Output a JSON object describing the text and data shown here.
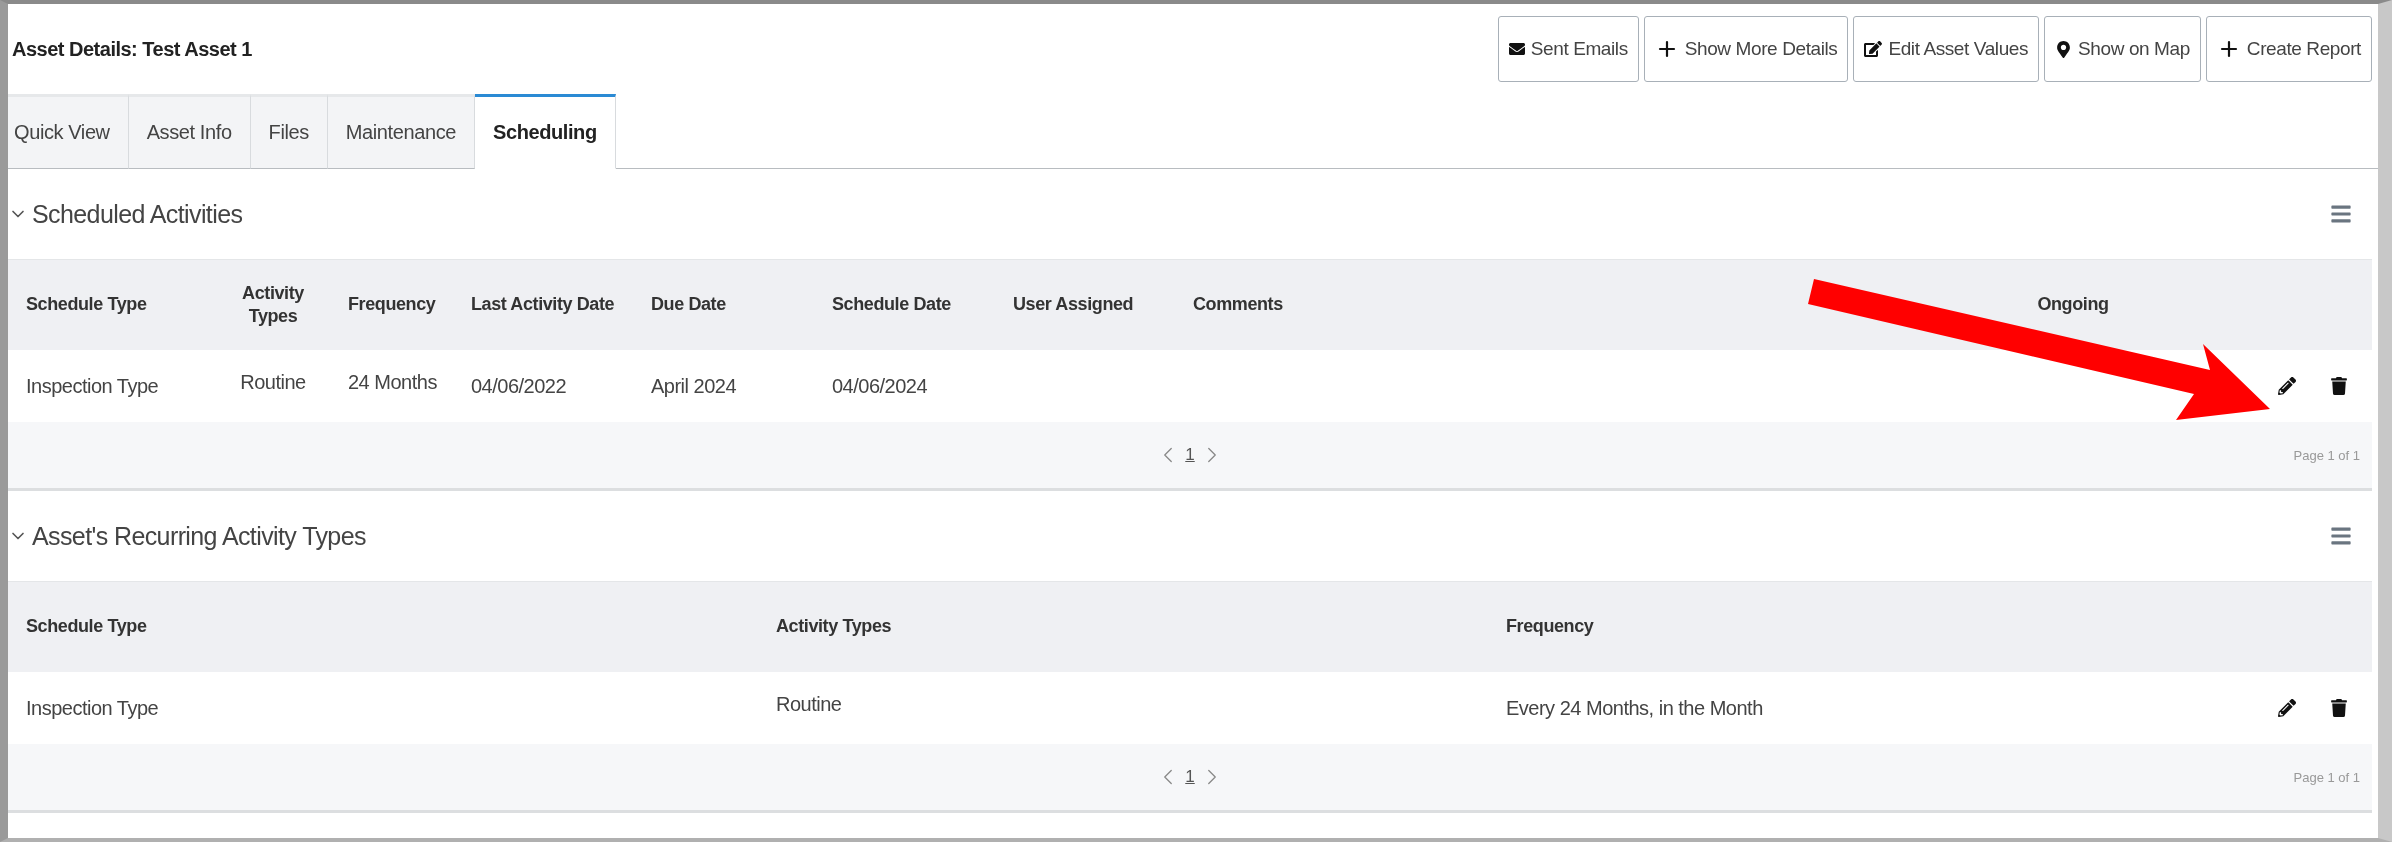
{
  "page": {
    "title": "Asset Details: Test Asset 1"
  },
  "actions": [
    {
      "label": "Sent Emails",
      "kind": "mail"
    },
    {
      "label": "Show More Details",
      "kind": "plus"
    },
    {
      "label": "Edit Asset Values",
      "kind": "edit"
    },
    {
      "label": "Show on Map",
      "kind": "pin"
    },
    {
      "label": "Create Report",
      "kind": "plus"
    }
  ],
  "tabs": [
    {
      "label": "Quick View",
      "selected": false
    },
    {
      "label": "Asset Info",
      "selected": false
    },
    {
      "label": "Files",
      "selected": false
    },
    {
      "label": "Maintenance",
      "selected": false
    },
    {
      "label": "Scheduling",
      "selected": true
    }
  ],
  "sections": [
    {
      "kind": "activities",
      "title": "Scheduled Activities",
      "expanded": true,
      "columns": [
        "Schedule Type",
        "Activity Types",
        "Frequency",
        "Last Activity Date",
        "Due Date",
        "Schedule Date",
        "User Assigned",
        "Comments",
        "Ongoing"
      ],
      "rows": [
        {
          "cells": [
            "Inspection Type",
            "Routine",
            "24 Months",
            "04/06/2022",
            "April 2024",
            "04/06/2024"
          ]
        }
      ],
      "pager": {
        "page": "1",
        "summary": "Page 1 of 1"
      }
    },
    {
      "kind": "recurring",
      "title": "Asset's Recurring Activity Types",
      "expanded": true,
      "columns": [
        "Schedule Type",
        "Activity Types",
        "Frequency"
      ],
      "rows": [
        {
          "cells": [
            "Inspection Type",
            "Routine",
            "Every 24 Months, in the Month"
          ]
        }
      ],
      "pager": {
        "page": "1",
        "summary": "Page 1 of 1"
      }
    }
  ]
}
